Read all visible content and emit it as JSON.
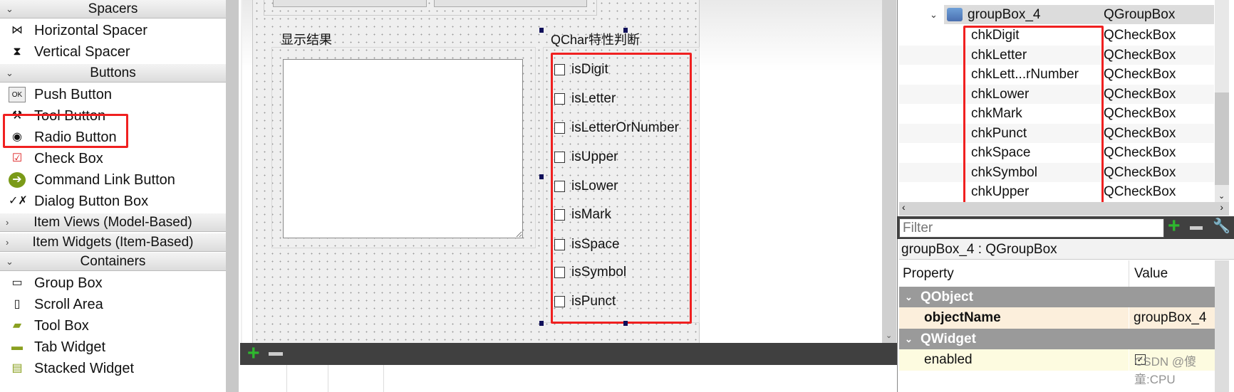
{
  "widget_box": {
    "categories": [
      {
        "label": "Spacers",
        "expanded": true,
        "items": [
          {
            "label": "Horizontal Spacer",
            "icon": "horizontal-spacer-icon"
          },
          {
            "label": "Vertical Spacer",
            "icon": "vertical-spacer-icon"
          }
        ]
      },
      {
        "label": "Buttons",
        "expanded": true,
        "items": [
          {
            "label": "Push Button",
            "icon": "push-button-icon"
          },
          {
            "label": "Tool Button",
            "icon": "tool-button-icon"
          },
          {
            "label": "Radio Button",
            "icon": "radio-button-icon"
          },
          {
            "label": "Check Box",
            "icon": "check-box-icon"
          },
          {
            "label": "Command Link Button",
            "icon": "command-link-icon"
          },
          {
            "label": "Dialog Button Box",
            "icon": "dialog-button-box-icon"
          }
        ]
      },
      {
        "label": "Item Views (Model-Based)",
        "expanded": false,
        "items": []
      },
      {
        "label": "Item Widgets (Item-Based)",
        "expanded": false,
        "items": []
      },
      {
        "label": "Containers",
        "expanded": true,
        "items": [
          {
            "label": "Group Box",
            "icon": "group-box-icon"
          },
          {
            "label": "Scroll Area",
            "icon": "scroll-area-icon"
          },
          {
            "label": "Tool Box",
            "icon": "tool-box-icon"
          },
          {
            "label": "Tab Widget",
            "icon": "tab-widget-icon"
          },
          {
            "label": "Stacked Widget",
            "icon": "stacked-widget-icon"
          }
        ]
      }
    ]
  },
  "form": {
    "result_group_title": "显示结果",
    "qchar_group_title": "QChar特性判断",
    "checkboxes": [
      "isDigit",
      "isLetter",
      "isLetterOrNumber",
      "isUpper",
      "isLower",
      "isMark",
      "isSpace",
      "isSymbol",
      "isPunct"
    ]
  },
  "object_inspector": {
    "parent": {
      "name": "groupBox_4",
      "class": "QGroupBox"
    },
    "children": [
      {
        "name": "chkDigit",
        "class": "QCheckBox"
      },
      {
        "name": "chkLetter",
        "class": "QCheckBox"
      },
      {
        "name": "chkLett...rNumber",
        "class": "QCheckBox"
      },
      {
        "name": "chkLower",
        "class": "QCheckBox"
      },
      {
        "name": "chkMark",
        "class": "QCheckBox"
      },
      {
        "name": "chkPunct",
        "class": "QCheckBox"
      },
      {
        "name": "chkSpace",
        "class": "QCheckBox"
      },
      {
        "name": "chkSymbol",
        "class": "QCheckBox"
      },
      {
        "name": "chkUpper",
        "class": "QCheckBox"
      }
    ]
  },
  "property_editor": {
    "filter_placeholder": "Filter",
    "object_label": "groupBox_4 : QGroupBox",
    "col_property": "Property",
    "col_value": "Value",
    "sections": [
      {
        "label": "QObject"
      },
      {
        "label": "QWidget"
      }
    ],
    "object_name_label": "objectName",
    "object_name_value": "groupBox_4",
    "enabled_label": "enabled",
    "enabled_checked": true
  },
  "watermark": "CSDN @傻童:CPU",
  "colors": {
    "highlight": "#f02020",
    "section": "#9a9a9a",
    "object_row": "#fcefdc",
    "enabled_row": "#fdfbe0"
  }
}
